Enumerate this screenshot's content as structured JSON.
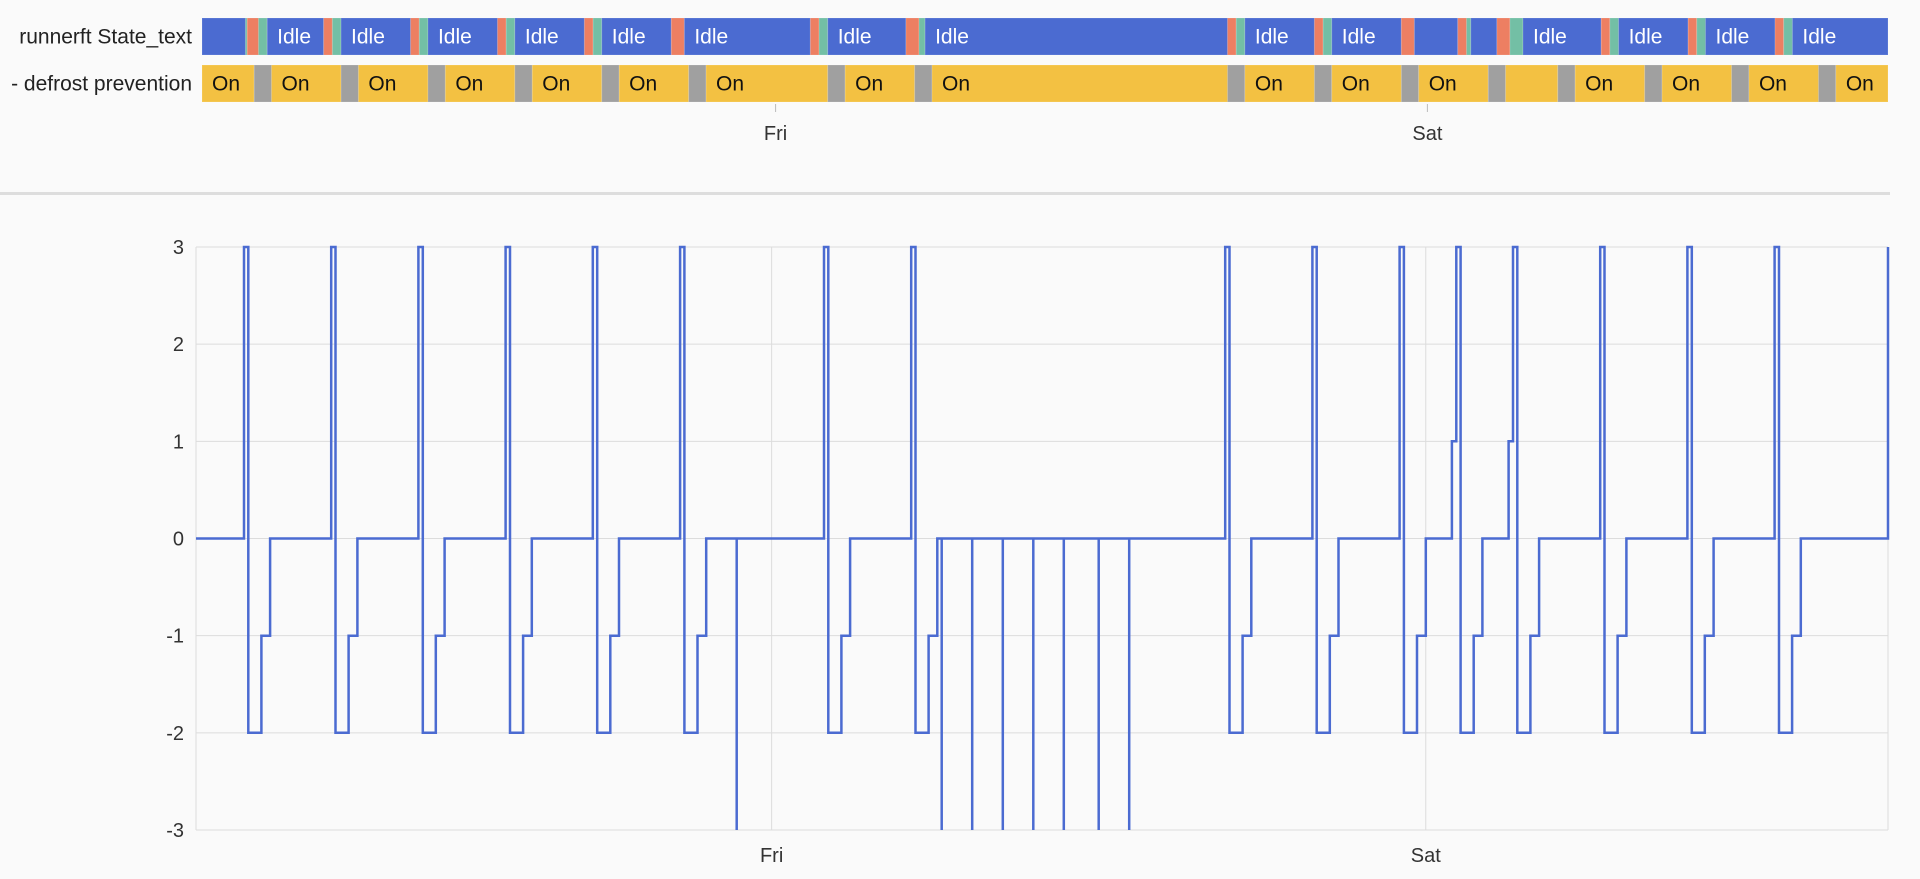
{
  "timeline": {
    "rows": [
      {
        "label": "runnerft State_text",
        "segments": [
          {
            "s": 0.0,
            "e": 0.5,
            "c": "blue"
          },
          {
            "s": 0.5,
            "e": 0.52,
            "c": "teal"
          },
          {
            "s": 0.52,
            "e": 0.65,
            "c": "orange"
          },
          {
            "s": 0.65,
            "e": 0.75,
            "c": "teal"
          },
          {
            "s": 0.75,
            "e": 1.4,
            "c": "blue",
            "t": "Idle"
          },
          {
            "s": 1.4,
            "e": 1.5,
            "c": "orange"
          },
          {
            "s": 1.5,
            "e": 1.6,
            "c": "teal"
          },
          {
            "s": 1.6,
            "e": 2.4,
            "c": "blue",
            "t": "Idle"
          },
          {
            "s": 2.4,
            "e": 2.5,
            "c": "orange"
          },
          {
            "s": 2.5,
            "e": 2.6,
            "c": "teal"
          },
          {
            "s": 2.6,
            "e": 3.4,
            "c": "blue",
            "t": "Idle"
          },
          {
            "s": 3.4,
            "e": 3.5,
            "c": "orange"
          },
          {
            "s": 3.5,
            "e": 3.6,
            "c": "teal"
          },
          {
            "s": 3.6,
            "e": 4.4,
            "c": "blue",
            "t": "Idle"
          },
          {
            "s": 4.4,
            "e": 4.5,
            "c": "orange"
          },
          {
            "s": 4.5,
            "e": 4.6,
            "c": "teal"
          },
          {
            "s": 4.6,
            "e": 5.4,
            "c": "blue",
            "t": "Idle"
          },
          {
            "s": 5.4,
            "e": 5.55,
            "c": "orange"
          },
          {
            "s": 5.55,
            "e": 7.0,
            "c": "blue",
            "t": "Idle"
          },
          {
            "s": 7.0,
            "e": 7.1,
            "c": "orange"
          },
          {
            "s": 7.1,
            "e": 7.2,
            "c": "teal"
          },
          {
            "s": 7.2,
            "e": 8.1,
            "c": "blue",
            "t": "Idle"
          },
          {
            "s": 8.1,
            "e": 8.25,
            "c": "orange"
          },
          {
            "s": 8.25,
            "e": 8.32,
            "c": "teal"
          },
          {
            "s": 8.32,
            "e": 11.8,
            "c": "blue",
            "t": "Idle"
          },
          {
            "s": 11.8,
            "e": 11.9,
            "c": "orange"
          },
          {
            "s": 11.9,
            "e": 12.0,
            "c": "teal"
          },
          {
            "s": 12.0,
            "e": 12.8,
            "c": "blue",
            "t": "Idle"
          },
          {
            "s": 12.8,
            "e": 12.9,
            "c": "orange"
          },
          {
            "s": 12.9,
            "e": 13.0,
            "c": "teal"
          },
          {
            "s": 13.0,
            "e": 13.8,
            "c": "blue",
            "t": "Idle"
          },
          {
            "s": 13.8,
            "e": 13.95,
            "c": "orange"
          },
          {
            "s": 13.95,
            "e": 14.45,
            "c": "blue"
          },
          {
            "s": 14.45,
            "e": 14.55,
            "c": "orange"
          },
          {
            "s": 14.55,
            "e": 14.6,
            "c": "teal"
          },
          {
            "s": 14.6,
            "e": 14.9,
            "c": "blue"
          },
          {
            "s": 14.9,
            "e": 15.05,
            "c": "orange"
          },
          {
            "s": 15.05,
            "e": 15.2,
            "c": "teal"
          },
          {
            "s": 15.2,
            "e": 16.1,
            "c": "blue",
            "t": "Idle"
          },
          {
            "s": 16.1,
            "e": 16.2,
            "c": "orange"
          },
          {
            "s": 16.2,
            "e": 16.3,
            "c": "teal"
          },
          {
            "s": 16.3,
            "e": 17.1,
            "c": "blue",
            "t": "Idle"
          },
          {
            "s": 17.1,
            "e": 17.2,
            "c": "orange"
          },
          {
            "s": 17.2,
            "e": 17.3,
            "c": "teal"
          },
          {
            "s": 17.3,
            "e": 18.1,
            "c": "blue",
            "t": "Idle"
          },
          {
            "s": 18.1,
            "e": 18.2,
            "c": "orange"
          },
          {
            "s": 18.2,
            "e": 18.3,
            "c": "teal"
          },
          {
            "s": 18.3,
            "e": 19.4,
            "c": "blue",
            "t": "Idle"
          }
        ]
      },
      {
        "label": "- defrost prevention",
        "segments": [
          {
            "s": 0.0,
            "e": 0.6,
            "c": "yellow",
            "t": "On"
          },
          {
            "s": 0.6,
            "e": 0.8,
            "c": "gray"
          },
          {
            "s": 0.8,
            "e": 1.6,
            "c": "yellow",
            "t": "On"
          },
          {
            "s": 1.6,
            "e": 1.8,
            "c": "gray"
          },
          {
            "s": 1.8,
            "e": 2.6,
            "c": "yellow",
            "t": "On"
          },
          {
            "s": 2.6,
            "e": 2.8,
            "c": "gray"
          },
          {
            "s": 2.8,
            "e": 3.6,
            "c": "yellow",
            "t": "On"
          },
          {
            "s": 3.6,
            "e": 3.8,
            "c": "gray"
          },
          {
            "s": 3.8,
            "e": 4.6,
            "c": "yellow",
            "t": "On"
          },
          {
            "s": 4.6,
            "e": 4.8,
            "c": "gray"
          },
          {
            "s": 4.8,
            "e": 5.6,
            "c": "yellow",
            "t": "On"
          },
          {
            "s": 5.6,
            "e": 5.8,
            "c": "gray"
          },
          {
            "s": 5.8,
            "e": 7.2,
            "c": "yellow",
            "t": "On"
          },
          {
            "s": 7.2,
            "e": 7.4,
            "c": "gray"
          },
          {
            "s": 7.4,
            "e": 8.2,
            "c": "yellow",
            "t": "On"
          },
          {
            "s": 8.2,
            "e": 8.4,
            "c": "gray"
          },
          {
            "s": 8.4,
            "e": 11.8,
            "c": "yellow",
            "t": "On"
          },
          {
            "s": 11.8,
            "e": 12.0,
            "c": "gray"
          },
          {
            "s": 12.0,
            "e": 12.8,
            "c": "yellow",
            "t": "On"
          },
          {
            "s": 12.8,
            "e": 13.0,
            "c": "gray"
          },
          {
            "s": 13.0,
            "e": 13.8,
            "c": "yellow",
            "t": "On"
          },
          {
            "s": 13.8,
            "e": 14.0,
            "c": "gray"
          },
          {
            "s": 14.0,
            "e": 14.8,
            "c": "yellow",
            "t": "On"
          },
          {
            "s": 14.8,
            "e": 15.0,
            "c": "gray"
          },
          {
            "s": 15.0,
            "e": 15.6,
            "c": "yellow"
          },
          {
            "s": 15.6,
            "e": 15.8,
            "c": "gray"
          },
          {
            "s": 15.8,
            "e": 16.6,
            "c": "yellow",
            "t": "On"
          },
          {
            "s": 16.6,
            "e": 16.8,
            "c": "gray"
          },
          {
            "s": 16.8,
            "e": 17.6,
            "c": "yellow",
            "t": "On"
          },
          {
            "s": 17.6,
            "e": 17.8,
            "c": "gray"
          },
          {
            "s": 17.8,
            "e": 18.6,
            "c": "yellow",
            "t": "On"
          },
          {
            "s": 18.6,
            "e": 18.8,
            "c": "gray"
          },
          {
            "s": 18.8,
            "e": 19.4,
            "c": "yellow",
            "t": "On"
          }
        ]
      }
    ],
    "colors": {
      "blue": "#4b6bd1",
      "teal": "#73bfa5",
      "orange": "#ed7f62",
      "yellow": "#f3c142",
      "gray": "#a0a0a0"
    },
    "ticks": [
      {
        "x": 6.6,
        "label": "Fri"
      },
      {
        "x": 14.1,
        "label": "Sat"
      }
    ]
  },
  "chart_data": {
    "type": "line",
    "step": true,
    "xlim": [
      0,
      19.4
    ],
    "ylim": [
      -3,
      3
    ],
    "yticks": [
      "3",
      "2",
      "1",
      "0",
      "-1",
      "-2",
      "-3"
    ],
    "x_ticks": [
      {
        "x": 6.6,
        "label": "Fri"
      },
      {
        "x": 14.1,
        "label": "Sat"
      }
    ],
    "grid": true,
    "color": "#4b6bd1",
    "series": [
      {
        "points": [
          [
            0.0,
            0
          ],
          [
            0.55,
            0
          ],
          [
            0.55,
            3
          ],
          [
            0.6,
            3
          ],
          [
            0.6,
            -2
          ],
          [
            0.75,
            -2
          ],
          [
            0.75,
            -1
          ],
          [
            0.85,
            -1
          ],
          [
            0.85,
            0
          ],
          [
            1.55,
            0
          ],
          [
            1.55,
            3
          ],
          [
            1.6,
            3
          ],
          [
            1.6,
            -2
          ],
          [
            1.75,
            -2
          ],
          [
            1.75,
            -1
          ],
          [
            1.85,
            -1
          ],
          [
            1.85,
            0
          ],
          [
            2.55,
            0
          ],
          [
            2.55,
            3
          ],
          [
            2.6,
            3
          ],
          [
            2.6,
            -2
          ],
          [
            2.75,
            -2
          ],
          [
            2.75,
            -1
          ],
          [
            2.85,
            -1
          ],
          [
            2.85,
            0
          ],
          [
            3.55,
            0
          ],
          [
            3.55,
            3
          ],
          [
            3.6,
            3
          ],
          [
            3.6,
            -2
          ],
          [
            3.75,
            -2
          ],
          [
            3.75,
            -1
          ],
          [
            3.85,
            -1
          ],
          [
            3.85,
            0
          ],
          [
            4.55,
            0
          ],
          [
            4.55,
            3
          ],
          [
            4.6,
            3
          ],
          [
            4.6,
            -2
          ],
          [
            4.75,
            -2
          ],
          [
            4.75,
            -1
          ],
          [
            4.85,
            -1
          ],
          [
            4.85,
            0
          ],
          [
            5.55,
            0
          ],
          [
            5.55,
            3
          ],
          [
            5.6,
            3
          ],
          [
            5.6,
            -2
          ],
          [
            5.75,
            -2
          ],
          [
            5.75,
            -1
          ],
          [
            5.85,
            -1
          ],
          [
            5.85,
            0
          ],
          [
            6.2,
            0
          ],
          [
            6.2,
            -3
          ],
          [
            6.2,
            0
          ],
          [
            7.2,
            0
          ],
          [
            7.2,
            3
          ],
          [
            7.25,
            3
          ],
          [
            7.25,
            -2
          ],
          [
            7.4,
            -2
          ],
          [
            7.4,
            -1
          ],
          [
            7.5,
            -1
          ],
          [
            7.5,
            0
          ],
          [
            8.2,
            0
          ],
          [
            8.2,
            3
          ],
          [
            8.25,
            3
          ],
          [
            8.25,
            -2
          ],
          [
            8.4,
            -2
          ],
          [
            8.4,
            -1
          ],
          [
            8.5,
            -1
          ],
          [
            8.5,
            0
          ],
          [
            8.55,
            0
          ],
          [
            8.55,
            -3
          ],
          [
            8.55,
            0
          ],
          [
            8.9,
            0
          ],
          [
            8.9,
            -3
          ],
          [
            8.9,
            0
          ],
          [
            9.25,
            0
          ],
          [
            9.25,
            -3
          ],
          [
            9.25,
            0
          ],
          [
            9.6,
            0
          ],
          [
            9.6,
            -3
          ],
          [
            9.6,
            0
          ],
          [
            9.95,
            0
          ],
          [
            9.95,
            -3
          ],
          [
            9.95,
            0
          ],
          [
            10.35,
            0
          ],
          [
            10.35,
            -3
          ],
          [
            10.35,
            0
          ],
          [
            10.7,
            0
          ],
          [
            10.7,
            -3
          ],
          [
            10.7,
            0
          ],
          [
            11.8,
            0
          ],
          [
            11.8,
            3
          ],
          [
            11.85,
            3
          ],
          [
            11.85,
            -2
          ],
          [
            12.0,
            -2
          ],
          [
            12.0,
            -1
          ],
          [
            12.1,
            -1
          ],
          [
            12.1,
            0
          ],
          [
            12.8,
            0
          ],
          [
            12.8,
            3
          ],
          [
            12.85,
            3
          ],
          [
            12.85,
            -2
          ],
          [
            13.0,
            -2
          ],
          [
            13.0,
            -1
          ],
          [
            13.1,
            -1
          ],
          [
            13.1,
            0
          ],
          [
            13.8,
            0
          ],
          [
            13.8,
            3
          ],
          [
            13.85,
            3
          ],
          [
            13.85,
            -2
          ],
          [
            14.0,
            -2
          ],
          [
            14.0,
            -1
          ],
          [
            14.1,
            -1
          ],
          [
            14.1,
            0
          ],
          [
            14.4,
            0
          ],
          [
            14.4,
            1
          ],
          [
            14.45,
            1
          ],
          [
            14.45,
            3
          ],
          [
            14.5,
            3
          ],
          [
            14.5,
            -2
          ],
          [
            14.65,
            -2
          ],
          [
            14.65,
            -1
          ],
          [
            14.75,
            -1
          ],
          [
            14.75,
            0
          ],
          [
            15.05,
            0
          ],
          [
            15.05,
            1
          ],
          [
            15.1,
            1
          ],
          [
            15.1,
            3
          ],
          [
            15.15,
            3
          ],
          [
            15.15,
            -2
          ],
          [
            15.3,
            -2
          ],
          [
            15.3,
            -1
          ],
          [
            15.4,
            -1
          ],
          [
            15.4,
            0
          ],
          [
            16.1,
            0
          ],
          [
            16.1,
            3
          ],
          [
            16.15,
            3
          ],
          [
            16.15,
            -2
          ],
          [
            16.3,
            -2
          ],
          [
            16.3,
            -1
          ],
          [
            16.4,
            -1
          ],
          [
            16.4,
            0
          ],
          [
            17.1,
            0
          ],
          [
            17.1,
            3
          ],
          [
            17.15,
            3
          ],
          [
            17.15,
            -2
          ],
          [
            17.3,
            -2
          ],
          [
            17.3,
            -1
          ],
          [
            17.4,
            -1
          ],
          [
            17.4,
            0
          ],
          [
            18.1,
            0
          ],
          [
            18.1,
            3
          ],
          [
            18.15,
            3
          ],
          [
            18.15,
            -2
          ],
          [
            18.3,
            -2
          ],
          [
            18.3,
            -1
          ],
          [
            18.4,
            -1
          ],
          [
            18.4,
            0
          ],
          [
            19.4,
            0
          ],
          [
            19.4,
            3
          ]
        ]
      }
    ]
  }
}
